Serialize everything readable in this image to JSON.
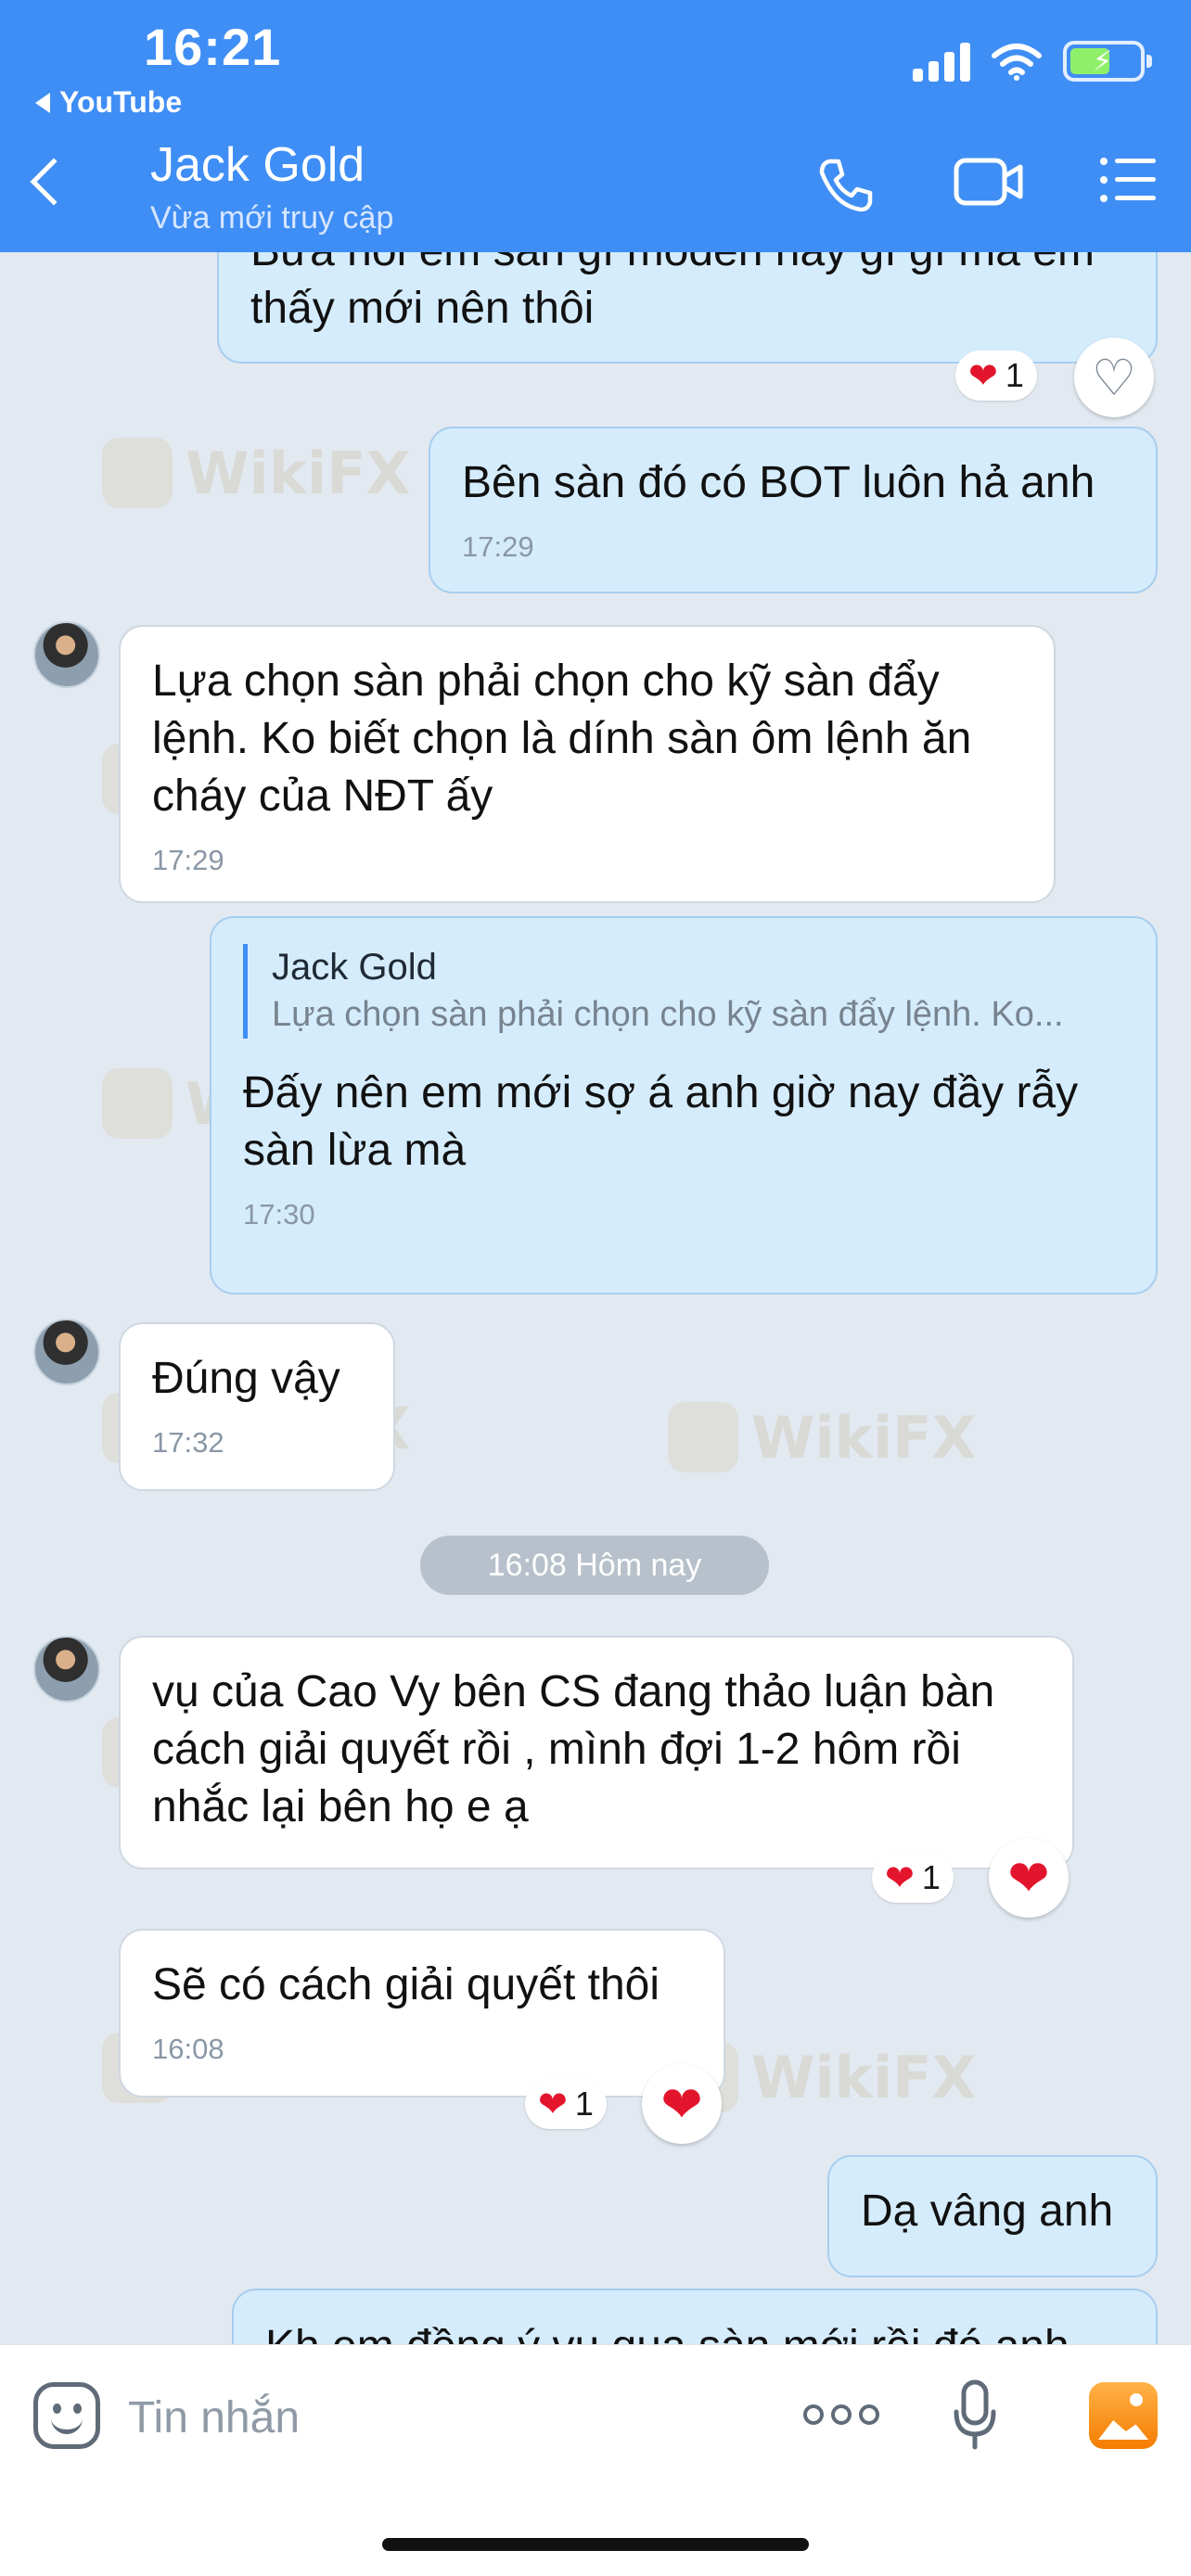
{
  "status_bar": {
    "time": "16:21",
    "back_app": "YouTube"
  },
  "header": {
    "contact_name": "Jack Gold",
    "contact_status": "Vừa mới truy cập"
  },
  "messages": [
    {
      "lines": "Bữa hỏi em sàn gì moden nay gì gì mà em thấy mới nên thôi",
      "reaction_count": "1"
    },
    {
      "text": "Bên sàn đó có BOT luôn hả anh",
      "time": "17:29"
    },
    {
      "text": "Lựa chọn sàn phải chọn cho kỹ sàn đẩy lệnh. Ko biết chọn là dính sàn ôm lệnh ăn cháy của NĐT ấy",
      "time": "17:29"
    },
    {
      "quote_name": "Jack Gold",
      "quote_text": "Lựa chọn sàn phải chọn cho kỹ sàn đẩy lệnh. Ko...",
      "text": "Đấy nên em mới sợ á anh giờ nay đầy rẫy sàn lừa mà",
      "time": "17:30"
    },
    {
      "text": "Đúng vậy",
      "time": "17:32"
    },
    {
      "text": "vụ của Cao Vy bên CS đang thảo luận bàn cách giải quyết rồi , mình đợi 1-2 hôm rồi nhắc lại bên họ e ạ",
      "reaction_count": "1"
    },
    {
      "text": "Sẽ có cách giải quyết thôi",
      "time": "16:08",
      "reaction_count": "1"
    },
    {
      "text": "Dạ vâng anh"
    },
    {
      "text": "Kh em đồng ý vụ qua sàn mới rồi đó anh"
    }
  ],
  "date_separator": "16:08 Hôm nay",
  "input": {
    "placeholder": "Tin nhắn"
  },
  "watermark": "WikiFX",
  "colors": {
    "header": "#3f8ef5",
    "outgoing_bubble": "#d5ecfd",
    "incoming_bubble": "#ffffff",
    "background": "#e2e9f1",
    "heart": "#e3152d"
  },
  "icons": [
    "back-chevron-icon",
    "phone-icon",
    "video-camera-icon",
    "list-menu-icon",
    "sticker-icon",
    "more-icon",
    "microphone-icon",
    "photo-icon",
    "heart-icon"
  ]
}
